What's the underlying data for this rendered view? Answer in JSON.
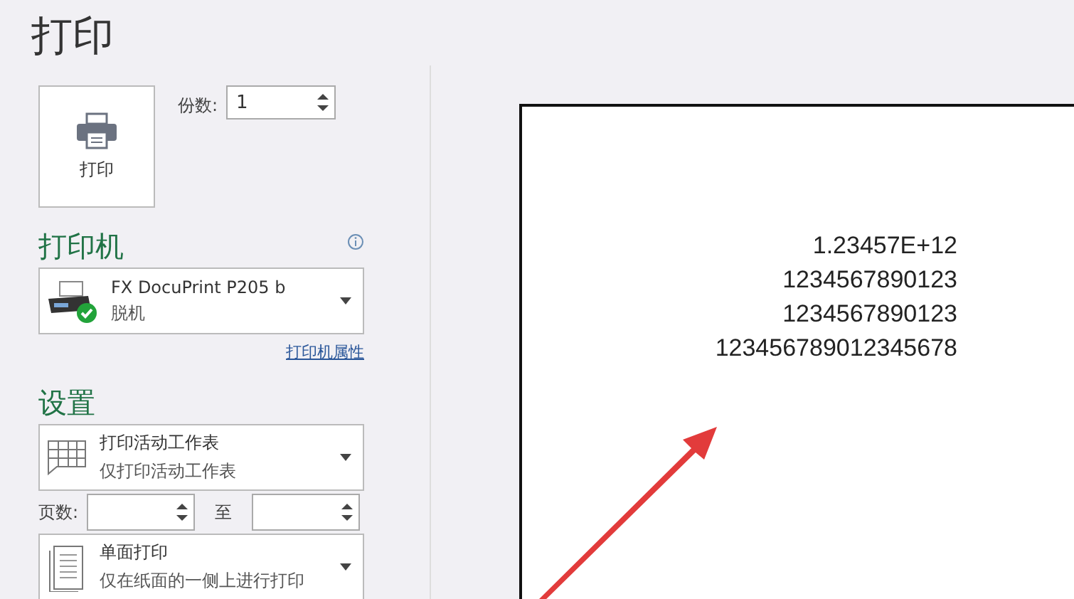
{
  "title": "打印",
  "print_button": {
    "label": "打印"
  },
  "copies": {
    "label": "份数:",
    "value": "1"
  },
  "printer": {
    "heading": "打印机",
    "name": "FX DocuPrint P205 b",
    "status": "脱机",
    "properties_link": "打印机属性"
  },
  "settings": {
    "heading": "设置",
    "scope": {
      "title": "打印活动工作表",
      "subtitle": "仅打印活动工作表"
    },
    "pages": {
      "label": "页数:",
      "to_label": "至"
    },
    "sides": {
      "title": "单面打印",
      "subtitle": "仅在纸面的一侧上进行打印"
    }
  },
  "preview": {
    "lines": [
      "1.23457E+12",
      "1234567890123",
      "1234567890123",
      "123456789012345678"
    ]
  }
}
